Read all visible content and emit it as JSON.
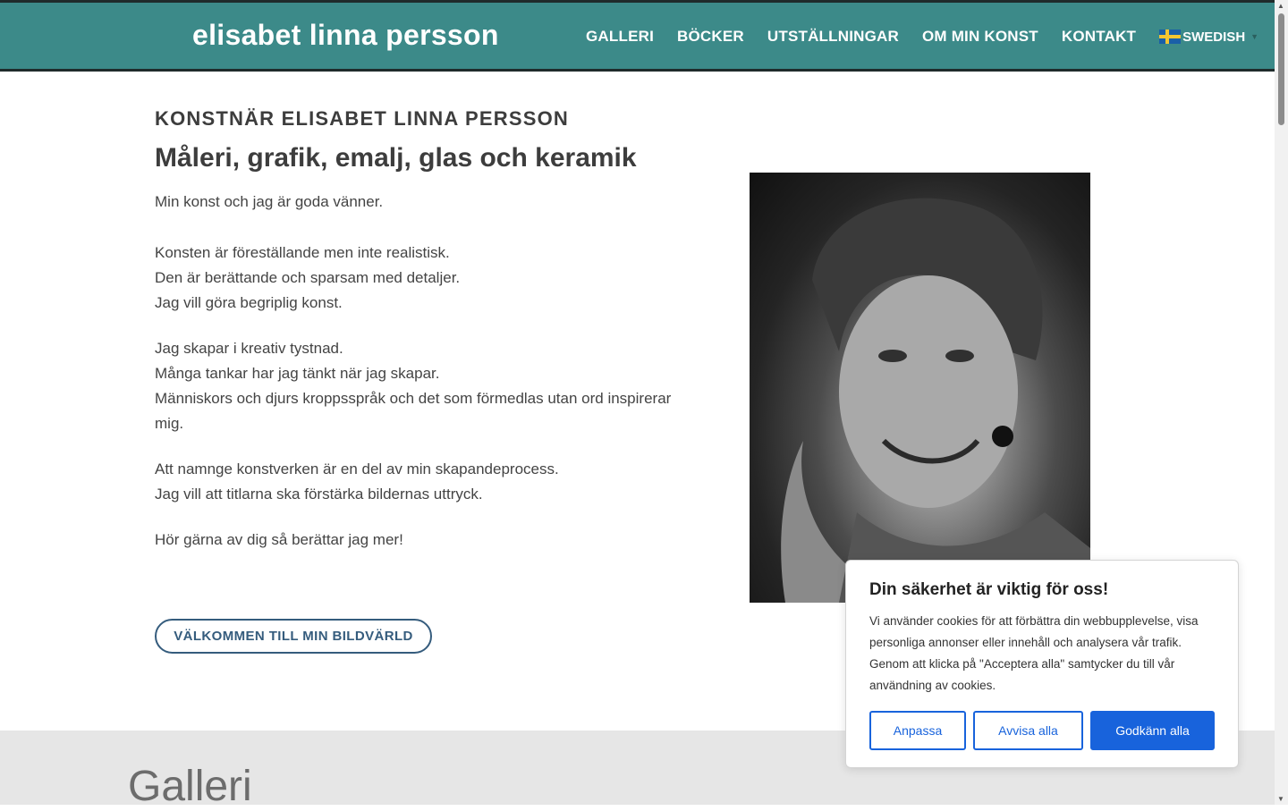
{
  "header": {
    "site_title": "elisabet linna persson",
    "nav": [
      "GALLERI",
      "BÖCKER",
      "UTSTÄLLNINGAR",
      "OM MIN KONST",
      "KONTAKT"
    ],
    "language": "SWEDISH",
    "colors": {
      "header_bg": "#3c8a89",
      "header_border": "#1f2b2b"
    }
  },
  "main": {
    "kicker": "KONSTNÄR ELISABET LINNA PERSSON",
    "headline": "Måleri, grafik, emalj, glas och keramik",
    "paragraphs": [
      [
        "Min konst och jag är goda vänner."
      ],
      [
        "Konsten är föreställande men inte realistisk.",
        "Den är berättande och sparsam med detaljer.",
        "Jag vill göra begriplig konst."
      ],
      [
        "Jag skapar i kreativ tystnad.",
        "Många tankar har jag tänkt när jag skapar.",
        "Människors och djurs kroppsspråk och det som förmedlas utan ord inspirerar mig."
      ],
      [
        "Att namnge konstverken är en del av min skapandeprocess.",
        "Jag vill att titlarna ska förstärka bildernas uttryck."
      ],
      [
        "Hör gärna av dig så berättar jag mer!"
      ]
    ],
    "cta_label": "VÄLKOMMEN TILL MIN BILDVÄRLD",
    "accent_color": "#355c7d"
  },
  "gallery": {
    "title": "Galleri"
  },
  "cookie": {
    "title": "Din säkerhet är viktig för oss!",
    "text": "Vi använder cookies för att förbättra din webbupplevelse, visa personliga annonser eller innehåll och analysera vår trafik. Genom att klicka på \"Acceptera alla\" samtycker du till vår användning av cookies.",
    "buttons": {
      "customize": "Anpassa",
      "reject": "Avvisa alla",
      "accept": "Godkänn alla"
    },
    "button_color": "#1863dc"
  }
}
